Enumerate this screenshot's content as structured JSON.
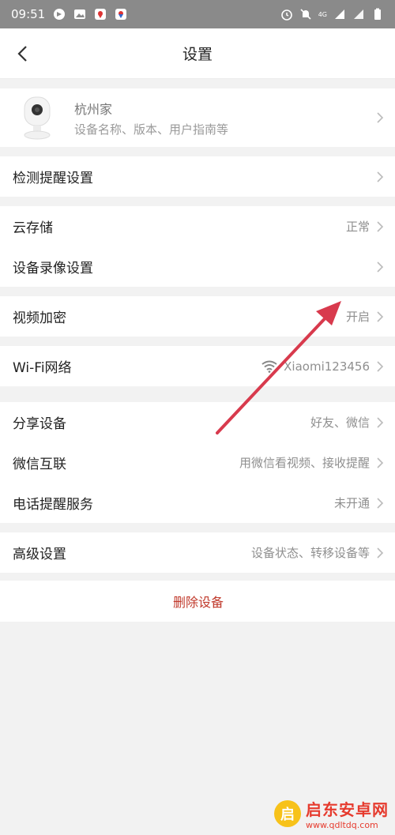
{
  "status_bar": {
    "time": "09:51",
    "icons_left": [
      "app-icon",
      "image-icon",
      "map-pin-icon",
      "map-pin-icon"
    ],
    "icons_right": [
      "alarm-icon",
      "bell-off-icon",
      "signal-4g-icon",
      "signal-icon",
      "battery-icon"
    ],
    "network_label": "4G"
  },
  "navbar": {
    "title": "设置"
  },
  "device": {
    "name": "杭州家",
    "subtitle": "设备名称、版本、用户指南等"
  },
  "groups": {
    "detection": {
      "label": "检测提醒设置"
    },
    "cloud": {
      "label": "云存储",
      "value": "正常"
    },
    "recording": {
      "label": "设备录像设置"
    },
    "encryption": {
      "label": "视频加密",
      "value": "开启"
    },
    "wifi": {
      "label": "Wi-Fi网络",
      "value": "Xiaomi123456"
    },
    "share": {
      "label": "分享设备",
      "value": "好友、微信"
    },
    "wechat": {
      "label": "微信互联",
      "value": "用微信看视频、接收提醒"
    },
    "phone": {
      "label": "电话提醒服务",
      "value": "未开通"
    },
    "advanced": {
      "label": "高级设置",
      "value": "设备状态、转移设备等"
    },
    "delete": {
      "label": "删除设备"
    }
  },
  "watermark": {
    "title": "启东安卓网",
    "url": "www.qdltdq.com",
    "logo_char": "启"
  },
  "colors": {
    "accent_red": "#c0392b",
    "arrow": "#d83a4d"
  }
}
